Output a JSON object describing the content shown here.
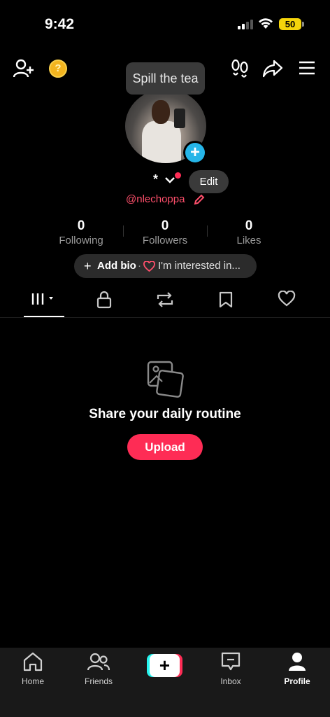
{
  "status_bar": {
    "time": "9:42",
    "battery": "50"
  },
  "coin_glyph": "?",
  "tooltip": "Spill the tea",
  "profile": {
    "name": "*",
    "edit_label": "Edit",
    "handle": "@nlechoppa"
  },
  "stats": [
    {
      "value": "0",
      "label": "Following"
    },
    {
      "value": "0",
      "label": "Followers"
    },
    {
      "value": "0",
      "label": "Likes"
    }
  ],
  "bio": {
    "plus": "+",
    "add_bio": "Add bio",
    "separator": "·",
    "interest": "I'm interested in..."
  },
  "tabs": [
    "videos-grid-icon",
    "lock-icon",
    "repost-icon",
    "bookmark-icon",
    "heart-icon"
  ],
  "empty_state": {
    "title": "Share your daily routine",
    "upload_label": "Upload"
  },
  "bottom_nav": {
    "home": "Home",
    "friends": "Friends",
    "create": "+",
    "inbox": "Inbox",
    "profile": "Profile"
  },
  "colors": {
    "accent": "#fe2c55",
    "handle": "#fe4f6b",
    "avatar_add": "#25b5e8",
    "battery": "#f5d50b"
  }
}
